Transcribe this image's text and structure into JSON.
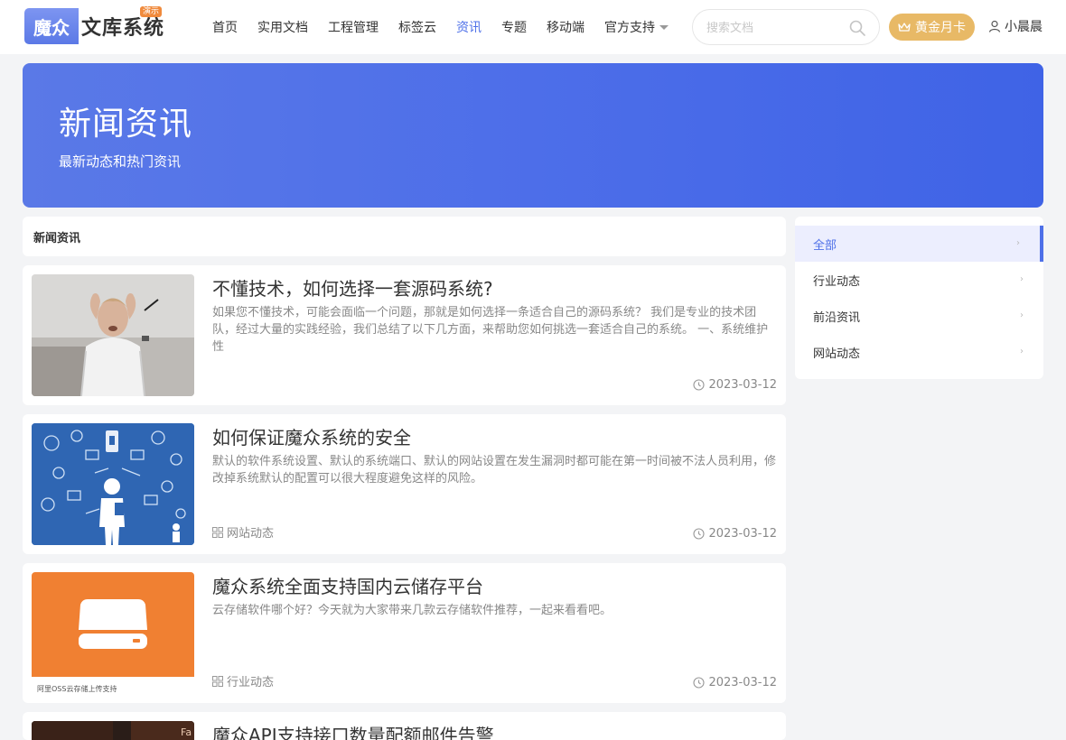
{
  "logo": {
    "mark": "魔众",
    "text": "文库系统",
    "badge": "演示"
  },
  "nav": [
    {
      "label": "首页"
    },
    {
      "label": "实用文档"
    },
    {
      "label": "工程管理"
    },
    {
      "label": "标签云"
    },
    {
      "label": "资讯",
      "active": true
    },
    {
      "label": "专题"
    },
    {
      "label": "移动端"
    },
    {
      "label": "官方支持",
      "dropdown": true
    }
  ],
  "search": {
    "placeholder": "搜索文档"
  },
  "vip": {
    "label": "黄金月卡"
  },
  "user": {
    "name": "小晨晨"
  },
  "banner": {
    "title": "新闻资讯",
    "subtitle": "最新动态和热门资讯"
  },
  "section": {
    "title": "新闻资讯"
  },
  "articles": [
    {
      "title": "不懂技术，如何选择一套源码系统?",
      "summary": "如果您不懂技术，可能会面临一个问题，那就是如何选择一条适合自己的源码系统？ 我们是专业的技术团队，经过大量的实践经验，我们总结了以下几方面，来帮助您如何挑选一套适合自己的系统。 一、系统维护性",
      "category": "",
      "date": "2023-03-12"
    },
    {
      "title": "如何保证魔众系统的安全",
      "summary": "默认的软件系统设置、默认的系统端口、默认的网站设置在发生漏洞时都可能在第一时间被不法人员利用，修改掉系统默认的配置可以很大程度避免这样的风险。",
      "category": "网站动态",
      "date": "2023-03-12"
    },
    {
      "title": "魔众系统全面支持国内云储存平台",
      "summary": "云存储软件哪个好？今天就为大家带来几款云存储软件推荐，一起来看看吧。",
      "category": "行业动态",
      "date": "2023-03-12",
      "thumb_caption": "阿里OSS云存储上传支持"
    },
    {
      "title": "魔众API支持接口数量配额邮件告警",
      "thumb_text": "Fa"
    }
  ],
  "sidebar": [
    {
      "label": "全部",
      "active": true
    },
    {
      "label": "行业动态"
    },
    {
      "label": "前沿资讯"
    },
    {
      "label": "网站动态"
    }
  ],
  "colors": {
    "accent": "#4e70e8",
    "banner": "#4d6ee9",
    "vip": "#e8b966",
    "orange": "#f08032",
    "security_blue": "#2f66b3"
  }
}
